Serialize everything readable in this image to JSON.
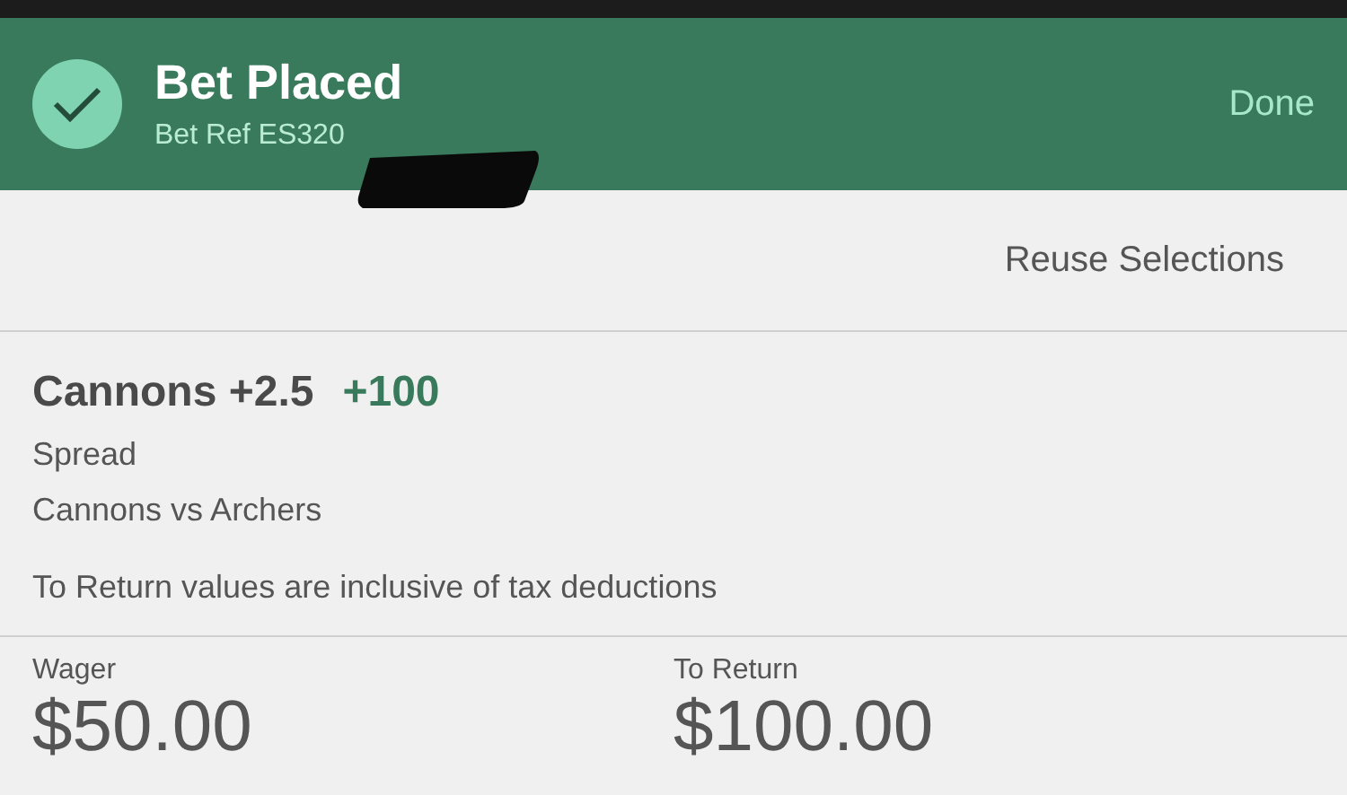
{
  "header": {
    "title": "Bet Placed",
    "bet_ref": "Bet Ref ES320",
    "done": "Done",
    "redacted": true
  },
  "reuse": "Reuse Selections",
  "selection": {
    "name": "Cannons +2.5",
    "odds": "+100",
    "market": "Spread",
    "event": "Cannons vs Archers",
    "note": "To Return values are inclusive of tax deductions"
  },
  "totals": [
    {
      "label": "Wager",
      "value": "$50.00"
    },
    {
      "label": "To Return",
      "value": "$100.00"
    }
  ]
}
